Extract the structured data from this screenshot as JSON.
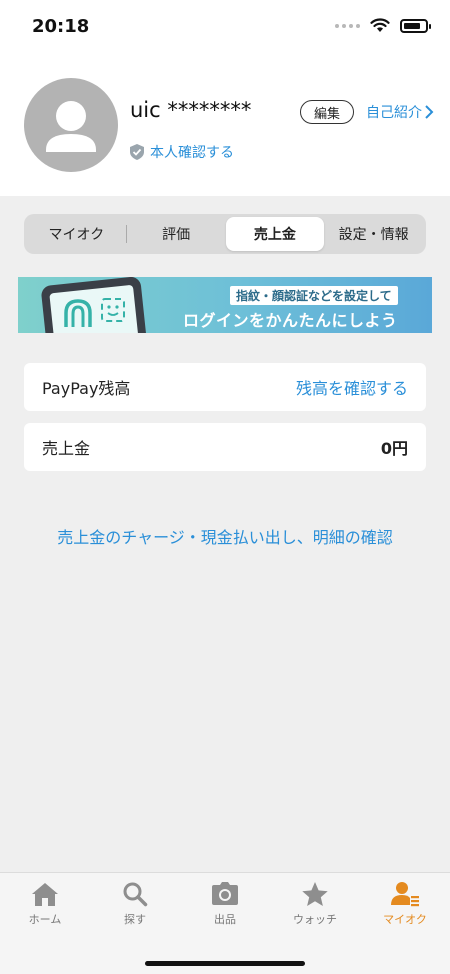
{
  "status": {
    "time": "20:18"
  },
  "profile": {
    "username": "uic ********",
    "verify_label": "本人確認する",
    "edit_label": "編集",
    "intro_label": "自己紹介"
  },
  "tabs": [
    {
      "label": "マイオク"
    },
    {
      "label": "評価"
    },
    {
      "label": "売上金"
    },
    {
      "label": "設定・情報"
    }
  ],
  "banner": {
    "small_text": "指紋・顔認証などを設定して",
    "big_text": "ログインをかんたんにしよう"
  },
  "cards": [
    {
      "label": "PayPay残高",
      "action": "残高を確認する"
    },
    {
      "label": "売上金",
      "value": "0円"
    }
  ],
  "bottom_link": "売上金のチャージ・現金払い出し、明細の確認",
  "tabbar": [
    {
      "label": "ホーム",
      "icon": "home-icon"
    },
    {
      "label": "探す",
      "icon": "search-icon"
    },
    {
      "label": "出品",
      "icon": "camera-icon"
    },
    {
      "label": "ウォッチ",
      "icon": "star-icon"
    },
    {
      "label": "マイオク",
      "icon": "user-list-icon"
    }
  ],
  "colors": {
    "link": "#2a8fd8",
    "active_tab": "#e48a1f"
  }
}
